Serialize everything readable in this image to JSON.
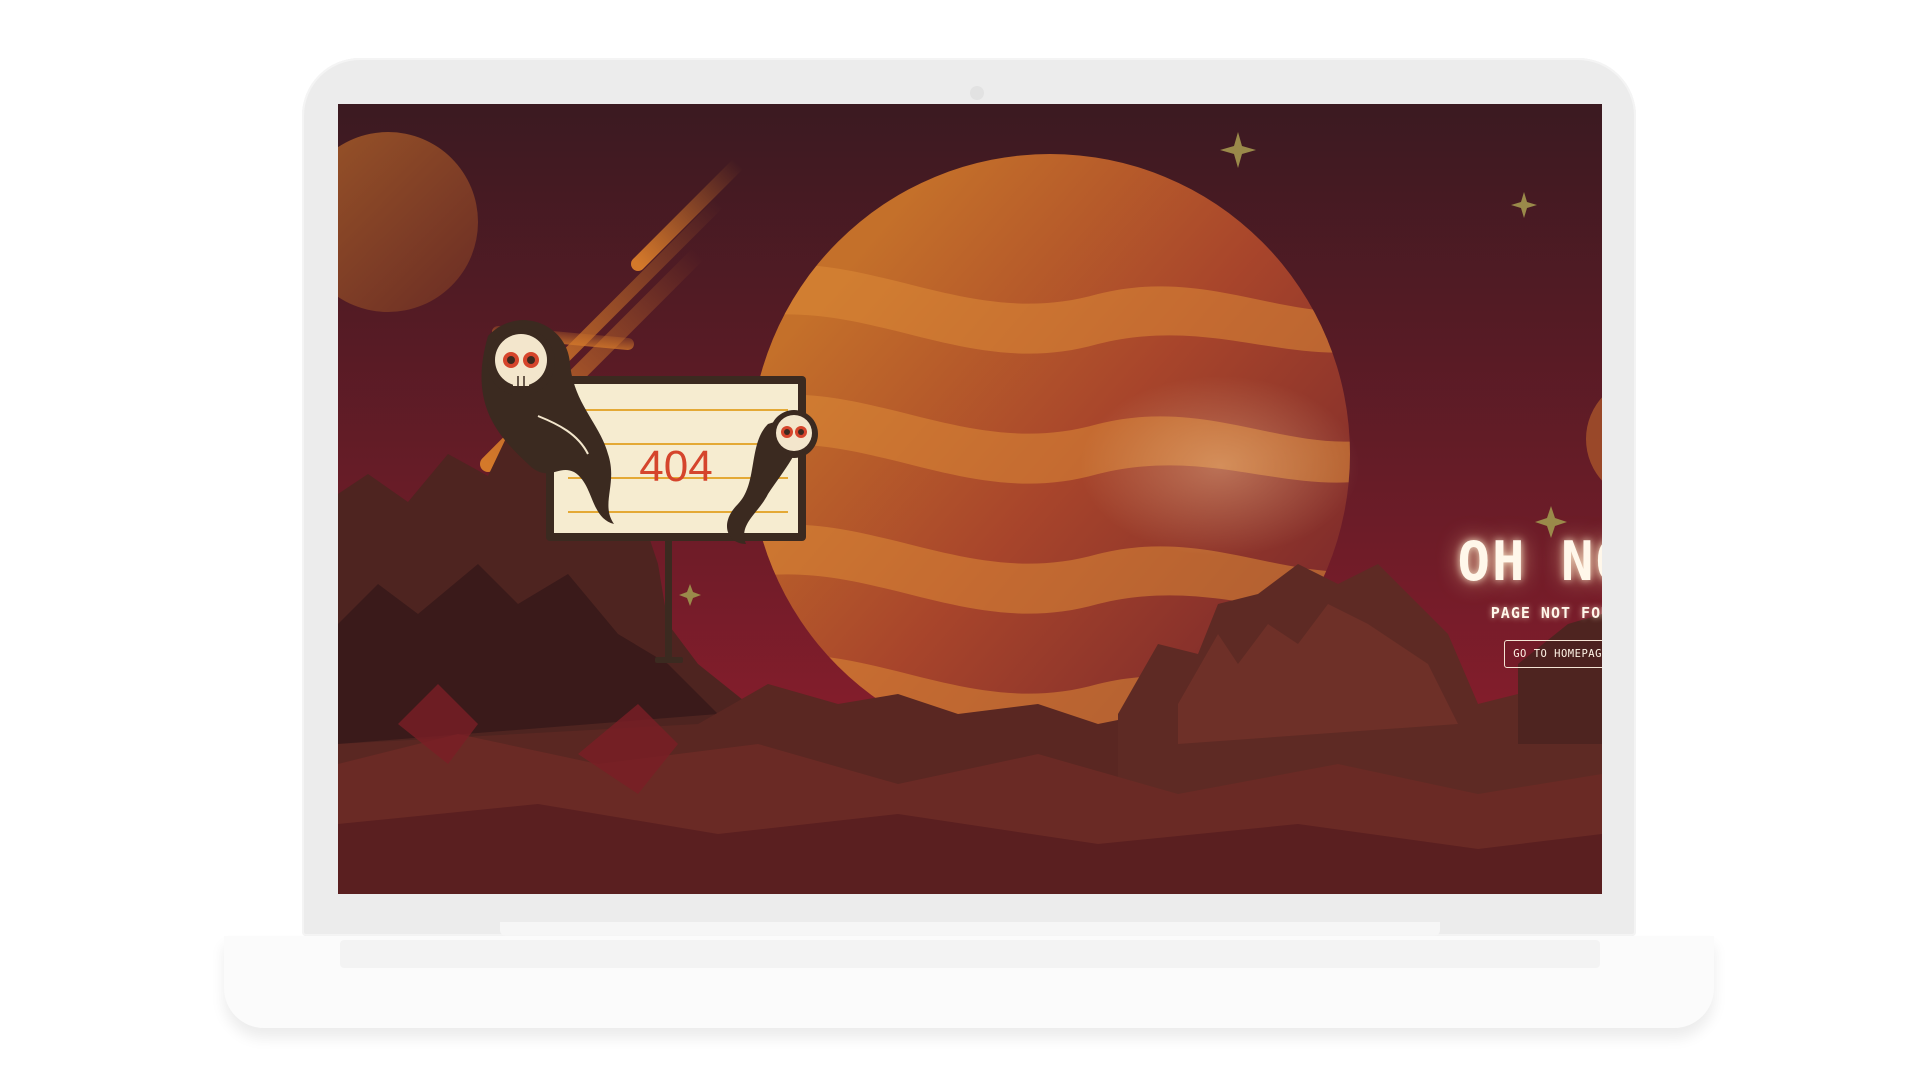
{
  "sign": {
    "code": "404"
  },
  "message": {
    "title": "OH NO!",
    "subtitle": "PAGE NOT FOUND",
    "button_label": "GO TO HOMEPAGE"
  },
  "colors": {
    "sky_top": "#3b1a21",
    "sky_bottom": "#9a1e2f",
    "planet": "#c8622a",
    "rock_dark": "#4a1f1c",
    "rock_mid": "#6e2e25",
    "sign_panel": "#f6ecd0",
    "sign_text": "#d5452c"
  }
}
